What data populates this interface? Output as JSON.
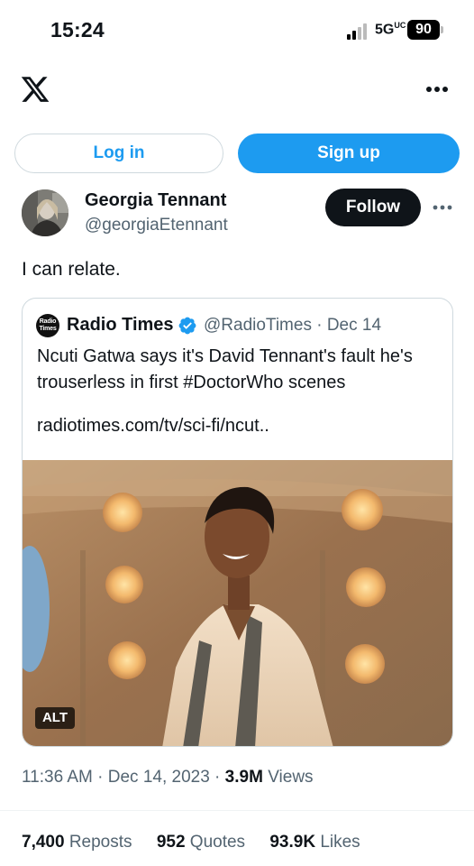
{
  "status_bar": {
    "time": "15:24",
    "network": "5G",
    "network_sub": "UC",
    "battery": "90"
  },
  "topbar": {
    "logo_icon": "x-logo-icon",
    "more_icon": "more-horizontal-icon"
  },
  "auth": {
    "login_label": "Log in",
    "signup_label": "Sign up"
  },
  "tweet": {
    "author_name": "Georgia Tennant",
    "author_handle": "@georgiaEtennant",
    "follow_label": "Follow",
    "text": "I can relate.",
    "timestamp": "11:36 AM · Dec 14, 2023 · ",
    "views_count": "3.9M",
    "views_label": " Views",
    "reposts_count": "7,400",
    "reposts_label": " Reposts",
    "quotes_count": "952",
    "quotes_label": " Quotes",
    "likes_count": "93.9K",
    "likes_label": " Likes"
  },
  "quoted": {
    "avatar_text_1": "Radio",
    "avatar_text_2": "Times",
    "name": "Radio Times",
    "verified": true,
    "meta": "@RadioTimes · Dec 14",
    "text": "Ncuti Gatwa says it's David Tennant's fault he's trouserless in first #DoctorWho scenes",
    "link": "radiotimes.com/tv/sci-fi/ncut..",
    "media_alt_badge": "ALT"
  },
  "colors": {
    "accent": "#1d9bf0",
    "text": "#0f1419",
    "muted": "#536471",
    "border": "#cfd9de"
  }
}
